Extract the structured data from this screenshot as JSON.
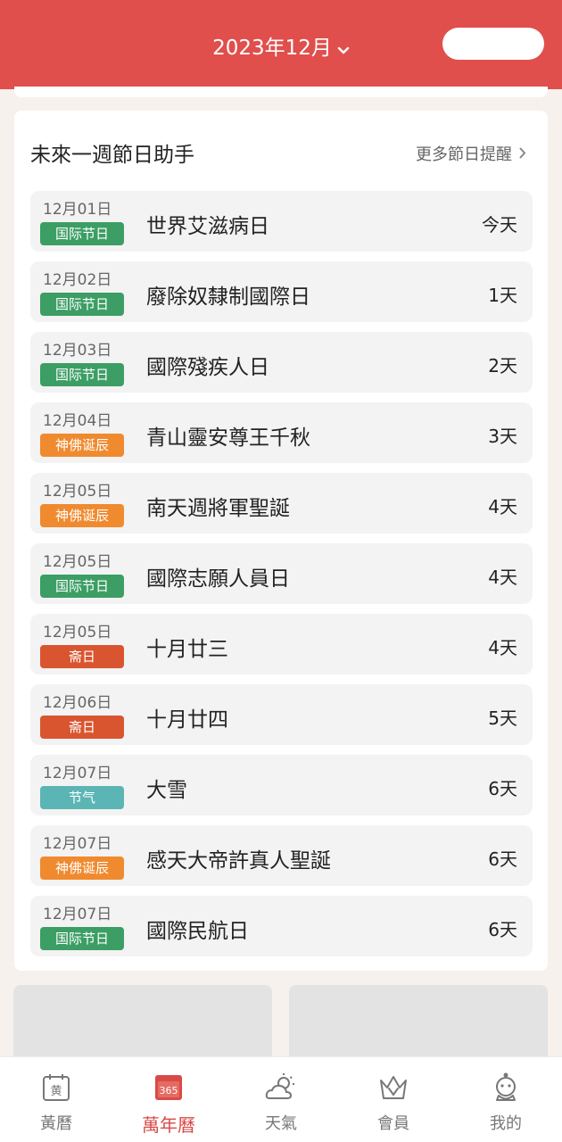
{
  "header": {
    "month_label": "2023年12月",
    "colors": {
      "background": "#e04f4c",
      "text": "#ffffff"
    }
  },
  "holiday_card": {
    "title": "未來一週節日助手",
    "more_link": "更多節日提醒"
  },
  "holidays": [
    {
      "date": "12月01日",
      "tag": "国际节日",
      "tag_color": "#3c9e64",
      "name": "世界艾滋病日",
      "days": "今天"
    },
    {
      "date": "12月02日",
      "tag": "国际节日",
      "tag_color": "#3c9e64",
      "name": "廢除奴隸制國際日",
      "days": "1天"
    },
    {
      "date": "12月03日",
      "tag": "国际节日",
      "tag_color": "#3c9e64",
      "name": "國際殘疾人日",
      "days": "2天"
    },
    {
      "date": "12月04日",
      "tag": "神佛诞辰",
      "tag_color": "#f08a2f",
      "name": "青山靈安尊王千秋",
      "days": "3天"
    },
    {
      "date": "12月05日",
      "tag": "神佛诞辰",
      "tag_color": "#f08a2f",
      "name": "南天週將軍聖誕",
      "days": "4天"
    },
    {
      "date": "12月05日",
      "tag": "国际节日",
      "tag_color": "#3c9e64",
      "name": "國際志願人員日",
      "days": "4天"
    },
    {
      "date": "12月05日",
      "tag": "斋日",
      "tag_color": "#d9552f",
      "name": "十月廿三",
      "days": "4天"
    },
    {
      "date": "12月06日",
      "tag": "斋日",
      "tag_color": "#d9552f",
      "name": "十月廿四",
      "days": "5天"
    },
    {
      "date": "12月07日",
      "tag": "节气",
      "tag_color": "#5bb5b5",
      "name": "大雪",
      "days": "6天"
    },
    {
      "date": "12月07日",
      "tag": "神佛诞辰",
      "tag_color": "#f08a2f",
      "name": "感天大帝許真人聖誕",
      "days": "6天"
    },
    {
      "date": "12月07日",
      "tag": "国际节日",
      "tag_color": "#3c9e64",
      "name": "國際民航日",
      "days": "6天"
    }
  ],
  "tabbar": {
    "items": [
      {
        "label": "黃曆",
        "icon": "almanac-icon",
        "icon_text": "黄",
        "active": false
      },
      {
        "label": "萬年曆",
        "icon": "calendar-365-icon",
        "icon_text": "365",
        "active": true
      },
      {
        "label": "天氣",
        "icon": "weather-icon",
        "active": false
      },
      {
        "label": "會員",
        "icon": "crown-icon",
        "active": false
      },
      {
        "label": "我的",
        "icon": "profile-icon",
        "active": false
      }
    ],
    "active_color": "#d94a46"
  }
}
